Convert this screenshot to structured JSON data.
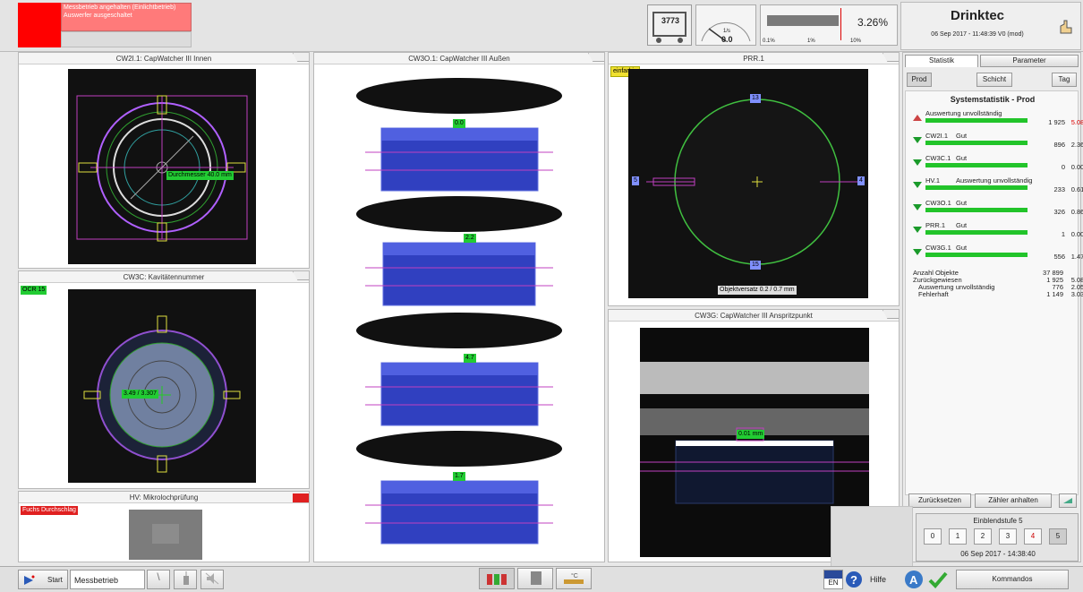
{
  "status": {
    "line1": "Messbetrieb angehalten (Einlichtbetrieb)",
    "line2": "Auswerfer ausgeschaltet",
    "color": "#ff0000"
  },
  "header": {
    "counter": "3773",
    "gauge_unit": "1/s",
    "gauge_value": "0.0",
    "reject_pct": "3.26%",
    "scale_ticks": [
      "0.1%",
      "1%",
      "10%"
    ],
    "title": "Drinktec",
    "datetime": "06 Sep 2017 - 11:48:39  V0 (mod)"
  },
  "panels": {
    "cw2i": {
      "title": "CW2I.1: CapWatcher III Innen",
      "label": "Durchmesser 40.0 mm"
    },
    "cw3c": {
      "title": "CW3C: Kavitätennummer",
      "ocr": "OCR 15",
      "label": "3.49 / 3.307"
    },
    "hv": {
      "title": "HV: Mikrolochprüfung",
      "alarm": "Fuchs Durchschlag"
    },
    "cw3o": {
      "title": "CW3O.1: CapWatcher III Außen",
      "labels": [
        "0.0",
        "2.2",
        "4.7",
        "1.7"
      ]
    },
    "prr": {
      "title": "PRR.1",
      "tag": "einfarbig",
      "top": "13",
      "bottom": "15",
      "left": "5",
      "right": "4",
      "offset": "Objektversatz 0.2 / 0.7 mm"
    },
    "cw3g": {
      "title": "CW3G: CapWatcher III Anspritzpunkt",
      "label": "0.01 mm"
    }
  },
  "side": {
    "tabs": [
      "Statistik",
      "Parameter"
    ],
    "buttons": [
      "Prod",
      "Schicht",
      "Tag"
    ],
    "heading": "Systemstatistik - Prod",
    "rows": [
      {
        "name": "Auswertung unvollständig",
        "status": "",
        "count": "1 925",
        "pct": "5.08%",
        "dir": "up"
      },
      {
        "name": "CW2I.1",
        "status": "Gut",
        "count": "896",
        "pct": "2.36%",
        "dir": "down"
      },
      {
        "name": "CW3C.1",
        "status": "Gut",
        "count": "0",
        "pct": "0.00%",
        "dir": "down"
      },
      {
        "name": "HV.1",
        "status": "Auswertung unvollständig",
        "count": "233",
        "pct": "0.61%",
        "dir": "down"
      },
      {
        "name": "CW3O.1",
        "status": "Gut",
        "count": "326",
        "pct": "0.86%",
        "dir": "down"
      },
      {
        "name": "PRR.1",
        "status": "Gut",
        "count": "1",
        "pct": "0.00%",
        "dir": "down"
      },
      {
        "name": "CW3G.1",
        "status": "Gut",
        "count": "556",
        "pct": "1.47%",
        "dir": "down"
      }
    ],
    "summary": [
      {
        "label": "Anzahl Objekte",
        "count": "37 899",
        "pct": ""
      },
      {
        "label": "Zurückgewiesen",
        "count": "1 925",
        "pct": "5.08%"
      },
      {
        "label": "Auswertung unvollständig",
        "count": "776",
        "pct": "2.05%"
      },
      {
        "label": "Fehlerhaft",
        "count": "1 149",
        "pct": "3.03%"
      }
    ],
    "reset": "Zurücksetzen",
    "stop": "Zähler anhalten",
    "level_title": "Einblendstufe 5",
    "levels": [
      "0",
      "1",
      "2",
      "3",
      "4",
      "5"
    ],
    "level_date": "06 Sep 2017 - 14:38:40"
  },
  "taskbar": {
    "start": "Start",
    "mode": "Messbetrieb",
    "lang": "EN",
    "help": "Hilfe",
    "commands": "Kommandos"
  }
}
